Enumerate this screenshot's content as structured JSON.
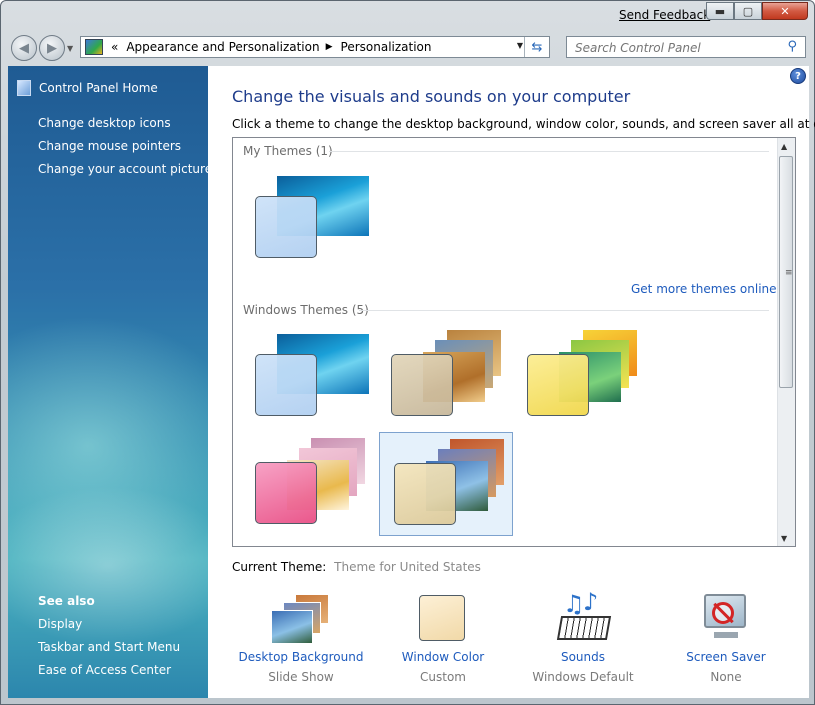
{
  "window": {
    "feedback_label": "Send Feedback",
    "caption_buttons": {
      "minimize": "▬",
      "maximize": "▢",
      "close": "✕"
    }
  },
  "toolbar": {
    "back_icon": "arrow-left-icon",
    "forward_icon": "arrow-right-icon",
    "breadcrumb_root": "«",
    "breadcrumbs": [
      "Appearance and Personalization",
      "Personalization"
    ],
    "search_placeholder": "Search Control Panel"
  },
  "sidebar": {
    "home_label": "Control Panel Home",
    "links": [
      "Change desktop icons",
      "Change mouse pointers",
      "Change your account picture"
    ],
    "see_also_label": "See also",
    "see_also_links": [
      "Display",
      "Taskbar and Start Menu",
      "Ease of Access Center"
    ]
  },
  "main": {
    "title": "Change the visuals and sounds on your computer",
    "subtitle": "Click a theme to change the desktop background, window color, sounds, and screen saver all at once.",
    "my_themes_label": "My Themes (1)",
    "windows_themes_label": "Windows Themes (5)",
    "get_more_label": "Get more themes online",
    "current_theme_label": "Current Theme:",
    "current_theme_value": "Theme for United States",
    "selected_theme_index": 4
  },
  "options": [
    {
      "label": "Desktop Background",
      "value": "Slide Show",
      "icon": "desktop-background-icon"
    },
    {
      "label": "Window Color",
      "value": "Custom",
      "icon": "window-color-icon"
    },
    {
      "label": "Sounds",
      "value": "Windows Default",
      "icon": "sounds-icon"
    },
    {
      "label": "Screen Saver",
      "value": "None",
      "icon": "screen-saver-icon"
    }
  ],
  "colors": {
    "link": "#1e5bbd",
    "title": "#1e3c8b",
    "sidebar_top": "#1f5b93",
    "sidebar_bottom": "#4bb3c0",
    "selection": "#e5f1fb"
  }
}
